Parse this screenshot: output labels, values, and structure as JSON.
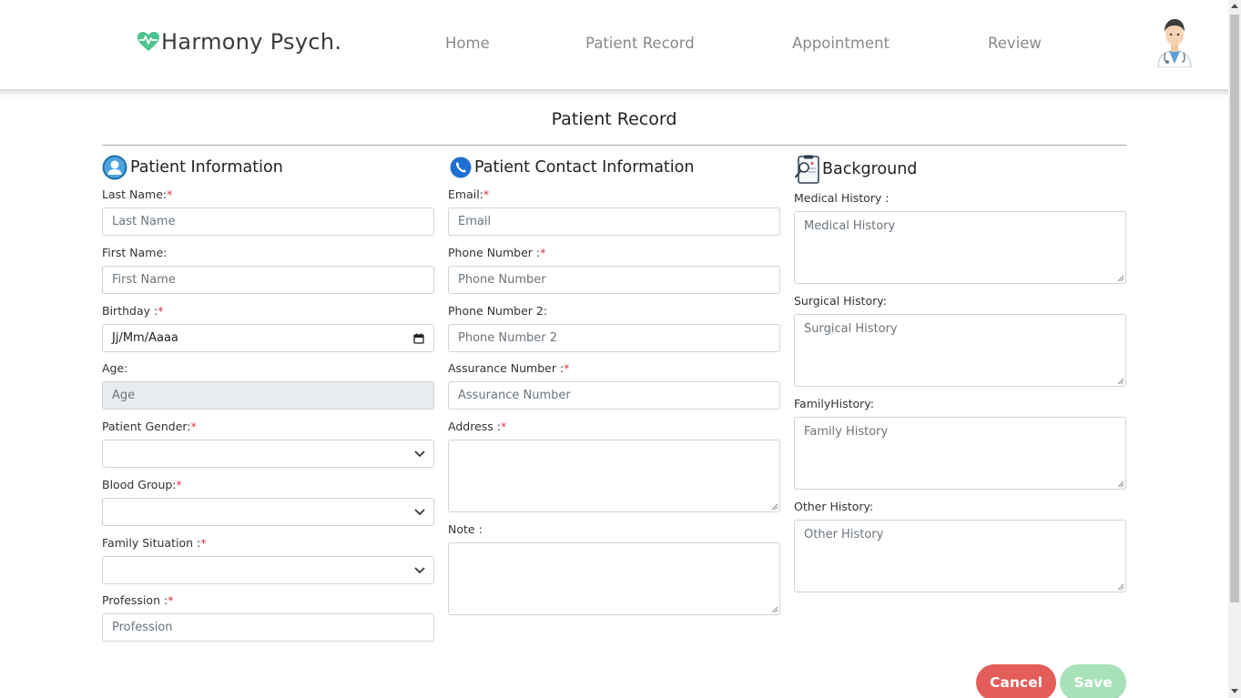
{
  "brand": {
    "name": "Harmony Psych."
  },
  "nav": {
    "home": "Home",
    "patient_record": "Patient Record",
    "appointment": "Appointment",
    "review": "Review"
  },
  "page": {
    "title": "Patient Record"
  },
  "patient_info": {
    "title": "Patient Information",
    "last_name": {
      "label": "Last Name:",
      "placeholder": "Last Name"
    },
    "first_name": {
      "label": "First Name:",
      "placeholder": "First Name"
    },
    "birthday": {
      "label": "Birthday :",
      "value": "Jj/Mm/Aaaa"
    },
    "age": {
      "label": "Age:",
      "placeholder": "Age"
    },
    "gender": {
      "label": "Patient Gender:",
      "value": ""
    },
    "blood_group": {
      "label": "Blood Group:",
      "value": ""
    },
    "family_situation": {
      "label": "Family Situation :",
      "value": ""
    },
    "profession": {
      "label": "Profession :",
      "placeholder": "Profession"
    }
  },
  "contact_info": {
    "title": "Patient Contact Information",
    "email": {
      "label": "Email:",
      "placeholder": "Email"
    },
    "phone": {
      "label": "Phone Number :",
      "placeholder": "Phone Number"
    },
    "phone2": {
      "label": "Phone Number 2:",
      "placeholder": "Phone Number 2"
    },
    "assurance": {
      "label": "Assurance Number :",
      "placeholder": "Assurance Number"
    },
    "address": {
      "label": "Address :",
      "value": ""
    },
    "note": {
      "label": "Note :",
      "value": ""
    }
  },
  "background": {
    "title": "Background",
    "medical": {
      "label": "Medical History :",
      "placeholder": "Medical History"
    },
    "surgical": {
      "label": "Surgical History:",
      "placeholder": "Surgical History"
    },
    "family": {
      "label": "FamilyHistory:",
      "placeholder": "Family History"
    },
    "other": {
      "label": "Other History:",
      "placeholder": "Other History"
    }
  },
  "required_mark": "*",
  "actions": {
    "cancel": "Cancel",
    "save": "Save"
  },
  "colors": {
    "brand_green": "#4cc38a",
    "required": "#dc3545",
    "cancel": "#e35d5b",
    "save": "#a8e2b8",
    "nav_text": "#8a8a8a"
  },
  "icons": {
    "brand": "heart-pulse-icon",
    "patient_info": "user-circle-icon",
    "contact": "phone-icon",
    "background": "clipboard-search-icon",
    "avatar": "doctor-avatar-icon"
  }
}
